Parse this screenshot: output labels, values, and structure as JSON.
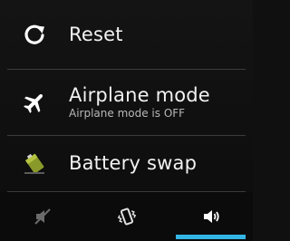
{
  "menu": {
    "items": [
      {
        "label": "Reset",
        "icon": "reset-icon"
      },
      {
        "label": "Airplane mode",
        "sublabel": "Airplane mode is OFF",
        "icon": "airplane-icon"
      },
      {
        "label": "Battery swap",
        "icon": "battery-swap-icon"
      }
    ]
  },
  "sound_modes": {
    "items": [
      {
        "icon": "silent-icon",
        "selected": false
      },
      {
        "icon": "vibrate-icon",
        "selected": false
      },
      {
        "icon": "sound-on-icon",
        "selected": true
      }
    ]
  },
  "colors": {
    "accent": "#33b5e5",
    "background": "#101010",
    "text": "#f2f2f2",
    "subtext": "#b8b8b8"
  }
}
